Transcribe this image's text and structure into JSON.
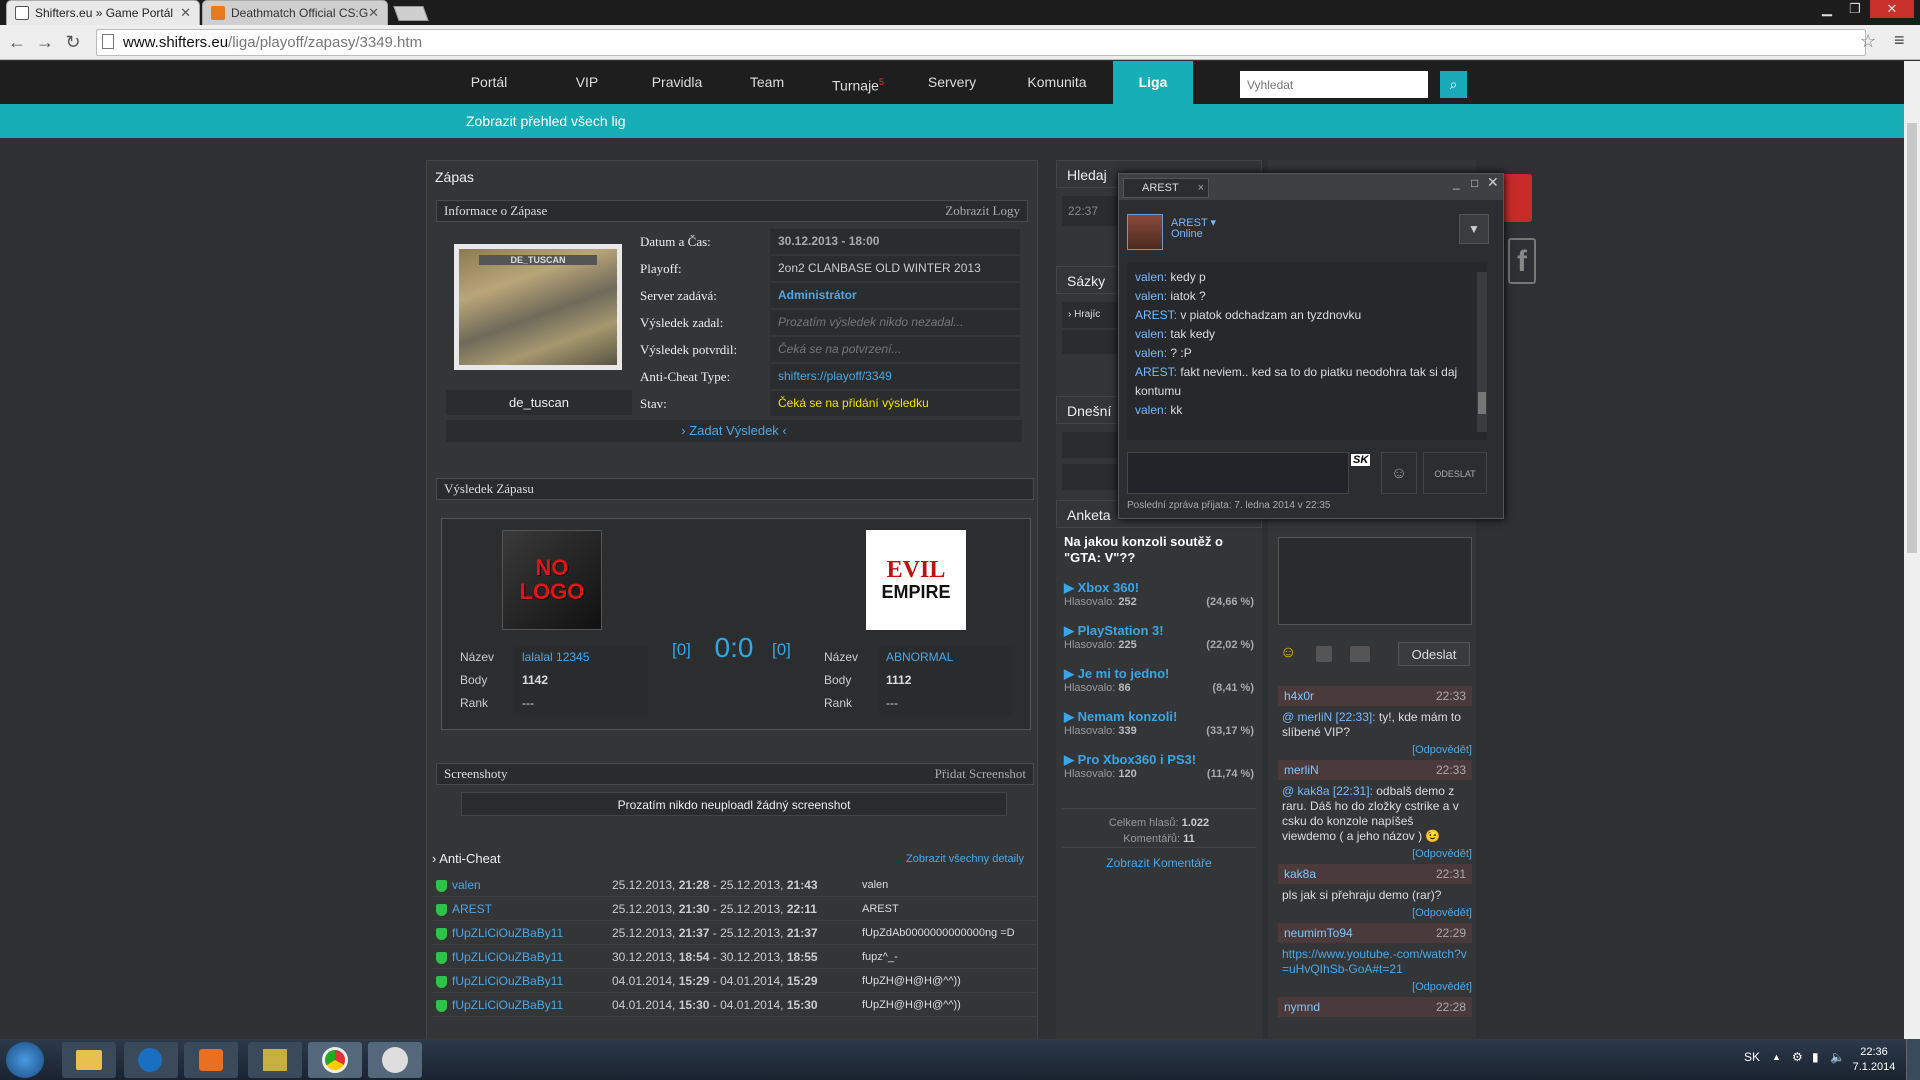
{
  "browser": {
    "tabs": [
      {
        "label": "Shifters.eu » Game Portál",
        "active": true
      },
      {
        "label": "Deathmatch Official CS:G",
        "active": false
      }
    ],
    "url_domain": "www.shifters.eu",
    "url_path": "/liga/playoff/zapasy/3349.htm"
  },
  "nav": {
    "items": [
      "Portál",
      "VIP",
      "Pravidla",
      "Team",
      "Turnaje",
      "Servery",
      "Komunita",
      "Liga"
    ],
    "turnaje_badge": "5",
    "active": "Liga",
    "search_placeholder": "Vyhledat"
  },
  "subnav": {
    "link": "Zobrazit přehled všech lig"
  },
  "match": {
    "panel_title": "Zápas",
    "info_title": "Informace o Zápase",
    "info_action": "Zobrazit Logy",
    "map_name": "de_tuscan",
    "map_caption": "DE_TUSCAN",
    "fields": [
      {
        "label": "Datum a Čas:",
        "value": "30.12.2013 - 18:00",
        "style": "bold"
      },
      {
        "label": "Playoff:",
        "value": "2on2 CLANBASE OLD WINTER 2013",
        "style": "normal"
      },
      {
        "label": "Server zadává:",
        "value": "Administrátor",
        "style": "link"
      },
      {
        "label": "Výsledek zadal:",
        "value": "Prozatím výsledek nikdo nezadal...",
        "style": "italic"
      },
      {
        "label": "Výsledek potvrdil:",
        "value": "Čeká se na potvrzení...",
        "style": "italic"
      },
      {
        "label": "Anti-Cheat Type:",
        "value": "shifters://playoff/3349",
        "style": "link"
      },
      {
        "label": "Stav:",
        "value": "Čeká se na přidání výsledku",
        "style": "yellow"
      }
    ],
    "enter_result": "› Zadat Výsledek ‹",
    "result_title": "Výsledek Zápasu",
    "team_left": {
      "logo": "NO LOGO",
      "name_label": "Název",
      "name": "lalalal 12345",
      "body_label": "Body",
      "body": "1142",
      "rank_label": "Rank",
      "rank": "---"
    },
    "team_right": {
      "logo_top": "EVIL",
      "logo_bottom": "EMPIRE",
      "name_label": "Název",
      "name": "ABNORMAL",
      "body_label": "Body",
      "body": "1112",
      "rank_label": "Rank",
      "rank": "---"
    },
    "score": "0:0",
    "score_left": "[0]",
    "score_right": "[0]",
    "screens_title": "Screenshoty",
    "screens_action": "Přidat Screenshot",
    "screens_empty": "Prozatím nikdo neuploadl žádný screenshot",
    "anticheat_title": "› Anti-Cheat",
    "anticheat_action": "Zobrazit všechny detaily",
    "anticheat_rows": [
      {
        "player": "valen",
        "d1": "25.12.2013, ",
        "t1": "21:28",
        "sep": " - ",
        "d2": "25.12.2013, ",
        "t2": "21:43",
        "nick": "valen"
      },
      {
        "player": "AREST",
        "d1": "25.12.2013, ",
        "t1": "21:30",
        "sep": " - ",
        "d2": "25.12.2013, ",
        "t2": "22:11",
        "nick": "AREST"
      },
      {
        "player": "fUpZLiCiOuZBaBy11",
        "d1": "25.12.2013, ",
        "t1": "21:37",
        "sep": " - ",
        "d2": "25.12.2013, ",
        "t2": "21:37",
        "nick": "fUpZdAb0000000000000ng =D"
      },
      {
        "player": "fUpZLiCiOuZBaBy11",
        "d1": "30.12.2013, ",
        "t1": "18:54",
        "sep": " - ",
        "d2": "30.12.2013, ",
        "t2": "18:55",
        "nick": "fupz^_-"
      },
      {
        "player": "fUpZLiCiOuZBaBy11",
        "d1": "04.01.2014, ",
        "t1": "15:29",
        "sep": " - ",
        "d2": "04.01.2014, ",
        "t2": "15:29",
        "nick": "fUpZH@H@H@^^))"
      },
      {
        "player": "fUpZLiCiOuZBaBy11",
        "d1": "04.01.2014, ",
        "t1": "15:30",
        "sep": " - ",
        "d2": "04.01.2014, ",
        "t2": "15:30",
        "nick": "fUpZH@H@H@^^))"
      }
    ]
  },
  "middle": {
    "hledaj": "Hledaj",
    "time": "22:37",
    "sazky": "Sázky",
    "hraci": "› Hrajíc",
    "dnesni": "Dnešní",
    "anketa": "Anketa",
    "poll_question": "Na jakou konzoli soutěž o \"GTA: V\"??",
    "poll_options": [
      {
        "name": "▶ Xbox 360!",
        "votes_label": "Hlasovalo: ",
        "votes": "252",
        "pct": "(24,66 %)"
      },
      {
        "name": "▶ PlayStation 3!",
        "votes_label": "Hlasovalo: ",
        "votes": "225",
        "pct": "(22,02 %)"
      },
      {
        "name": "▶ Je mi to jedno!",
        "votes_label": "Hlasovalo: ",
        "votes": "86",
        "pct": "(8,41 %)"
      },
      {
        "name": "▶ Nemam konzoli!",
        "votes_label": "Hlasovalo: ",
        "votes": "339",
        "pct": "(33,17 %)"
      },
      {
        "name": "▶ Pro Xbox360 i PS3!",
        "votes_label": "Hlasovalo: ",
        "votes": "120",
        "pct": "(11,74 %)"
      }
    ],
    "total_label": "Celkem hlasů: ",
    "total": "1.022",
    "comments_label": "Komentářů: ",
    "comments": "11",
    "show_comments": "Zobrazit Komentáře"
  },
  "shoutbox": {
    "send": "Odeslat",
    "reply": "[Odpovědět]",
    "entries": [
      {
        "name": "h4x0r",
        "time": "22:33",
        "quote": "@ merliN [22:33]:",
        "text": " ty!, kde mám to slíbené VIP?"
      },
      {
        "name": "merliN",
        "time": "22:33",
        "quote": "@ kak8a [22:31]:",
        "text": " odbalš demo z raru. Dáš ho do zložky cstrike a v csku do konzole napíšeš viewdemo ( a jeho názov ) 😉"
      },
      {
        "name": "kak8a",
        "time": "22:31",
        "quote": "",
        "text": "pls jak si přehraju demo (rar)?"
      },
      {
        "name": "neumimTo94",
        "time": "22:29",
        "quote": "",
        "text": "https://www.youtube.-com/watch?v=uHvQIhSb-GoA#t=21"
      },
      {
        "name": "nymnd",
        "time": "22:28",
        "quote": "",
        "text": ""
      }
    ]
  },
  "steam": {
    "tab": "AREST",
    "user": "AREST",
    "status": "Online",
    "messages": [
      {
        "n": "valen:",
        "t": " kedy p"
      },
      {
        "n": "valen:",
        "t": " iatok ?"
      },
      {
        "n": "AREST:",
        "t": " v piatok odchadzam an tyzdnovku"
      },
      {
        "n": "valen:",
        "t": " tak kedy"
      },
      {
        "n": "valen:",
        "t": " ? :P"
      },
      {
        "n": "AREST:",
        "t": " fakt neviem.. ked sa to do piatku neodohra tak si daj kontumu"
      },
      {
        "n": "valen:",
        "t": " kk"
      }
    ],
    "lang": "SK",
    "send": "ODESLAT",
    "last_msg": "Poslední zpráva přijata: 7. ledna 2014 v 22:35"
  },
  "taskbar": {
    "lang": "SK",
    "time": "22:36",
    "date": "7.1.2014"
  }
}
